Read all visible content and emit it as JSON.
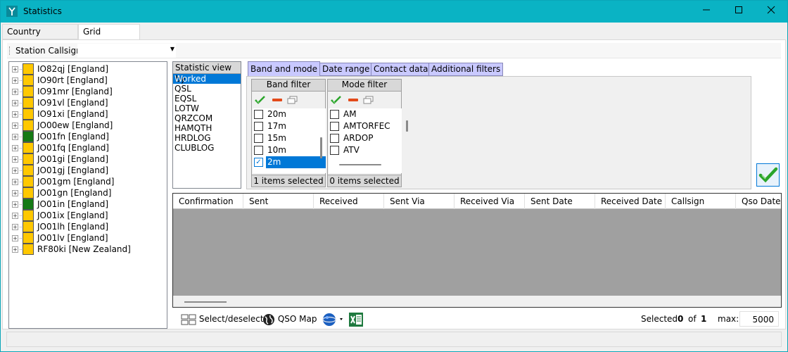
{
  "window": {
    "title": "Statistics",
    "minimize": "—",
    "maximize": "☐",
    "close": "✕"
  },
  "tabs": [
    {
      "label": "Country Statistics"
    },
    {
      "label": "Grid Statistics"
    }
  ],
  "toolbar": {
    "station_label": "Station Callsign",
    "station_value": ""
  },
  "tree": [
    {
      "label": "IO82qj [England]",
      "color": "#ffc800"
    },
    {
      "label": "IO90rt [England]",
      "color": "#ffc800"
    },
    {
      "label": "IO91mr [England]",
      "color": "#ffc800"
    },
    {
      "label": "IO91vl [England]",
      "color": "#ffc800"
    },
    {
      "label": "IO91xi [England]",
      "color": "#ffc800"
    },
    {
      "label": "JO00ew [England]",
      "color": "#ffc800"
    },
    {
      "label": "JO01fn [England]",
      "color": "#157a15"
    },
    {
      "label": "JO01fq [England]",
      "color": "#ffc800"
    },
    {
      "label": "JO01gi [England]",
      "color": "#ffc800"
    },
    {
      "label": "JO01gj [England]",
      "color": "#ffc800"
    },
    {
      "label": "JO01gm [England]",
      "color": "#ffc800"
    },
    {
      "label": "JO01gn [England]",
      "color": "#ffc800"
    },
    {
      "label": "JO01in [England]",
      "color": "#157a15"
    },
    {
      "label": "JO01ix [England]",
      "color": "#ffc800"
    },
    {
      "label": "JO01lh [England]",
      "color": "#ffc800"
    },
    {
      "label": "JO01lv [England]",
      "color": "#ffc800"
    },
    {
      "label": "RF80ki [New Zealand]",
      "color": "#ffc800"
    }
  ],
  "statistic_view": {
    "header": "Statistic view by",
    "items": [
      "Worked",
      "QSL",
      "EQSL",
      "LOTW",
      "QRZCOM",
      "HAMQTH",
      "HRDLOG",
      "CLUBLOG"
    ],
    "selected": "Worked"
  },
  "filter_tabs": [
    {
      "label": "Band and mode"
    },
    {
      "label": "Date range"
    },
    {
      "label": "Contact data"
    },
    {
      "label": "Additional filters"
    }
  ],
  "band_filter": {
    "header": "Band filter",
    "items": [
      {
        "label": "20m",
        "checked": false
      },
      {
        "label": "17m",
        "checked": false
      },
      {
        "label": "15m",
        "checked": false
      },
      {
        "label": "10m",
        "checked": false
      },
      {
        "label": "2m",
        "checked": true
      }
    ],
    "footer": "1 items selected"
  },
  "mode_filter": {
    "header": "Mode filter",
    "items": [
      {
        "label": "AM",
        "checked": false
      },
      {
        "label": "AMTORFEC",
        "checked": false
      },
      {
        "label": "ARDOP",
        "checked": false
      },
      {
        "label": "ATV",
        "checked": false
      }
    ],
    "footer": "0 items selected"
  },
  "grid": {
    "columns": [
      "Confirmation",
      "Sent",
      "Received",
      "Sent Via",
      "Received Via",
      "Sent Date",
      "Received Date",
      "Callsign",
      "Qso Date"
    ]
  },
  "bottom": {
    "select_label": "Select/deselect",
    "qso_map_label": "QSO Map",
    "selected_label": "Selected",
    "selected_count": "0",
    "of_label": "of",
    "total": "1",
    "max_label": "max:",
    "max_value": "5000"
  },
  "icons": {
    "check": "check-icon",
    "remove": "minus-icon",
    "toggle": "window-icon",
    "globe": "globe-icon",
    "excel": "excel-icon"
  },
  "colors": {
    "titlebar": "#0ab3c4",
    "selection": "#0078d7",
    "tab_purple": "#c9c9ff",
    "worked": "#157a15",
    "not_confirmed": "#ffc800"
  }
}
